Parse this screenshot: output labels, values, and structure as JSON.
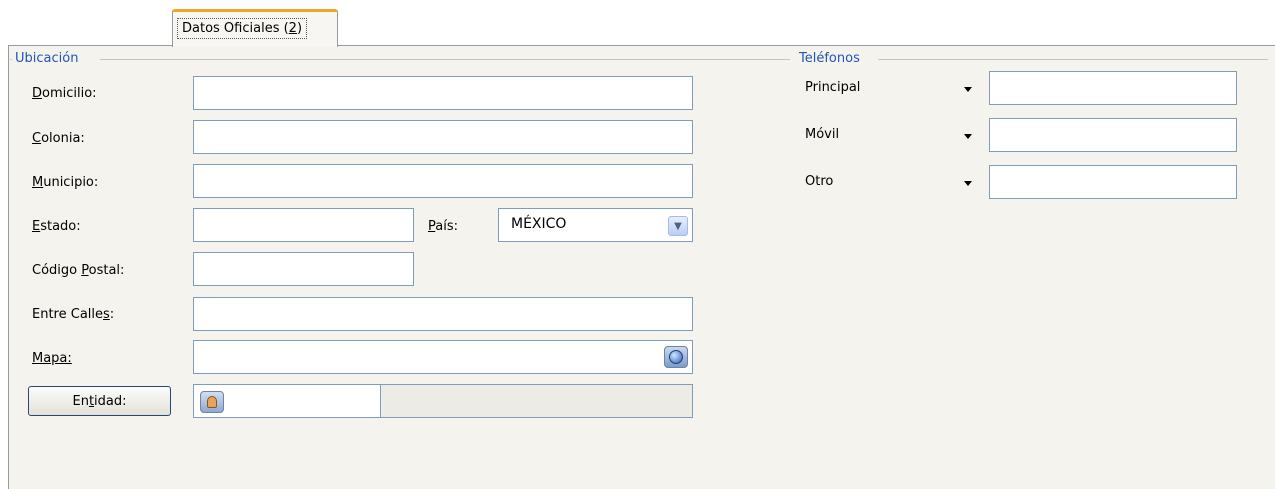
{
  "tab": {
    "label_prefix": "Datos Oficiales (",
    "label_accel": "2",
    "label_suffix": ")"
  },
  "ubicacion": {
    "title": "Ubicación",
    "domicilio": {
      "accel": "D",
      "rest": "omicilio:",
      "value": ""
    },
    "colonia": {
      "accel": "C",
      "rest": "olonia:",
      "value": ""
    },
    "municipio": {
      "accel": "M",
      "rest": "unicipio:",
      "value": ""
    },
    "estado": {
      "accel": "E",
      "rest": "stado:",
      "value": ""
    },
    "pais": {
      "accel": "P",
      "rest": "aís:",
      "selected": "MÉXICO"
    },
    "codigo_postal": {
      "pre": "Código ",
      "accel": "P",
      "rest": "ostal:",
      "value": ""
    },
    "entre_calles": {
      "pre": "Entre Calle",
      "accel": "s",
      "rest": ":",
      "value": ""
    },
    "mapa": {
      "label": "Mapa:",
      "value": ""
    },
    "entidad_button": {
      "pre": "En",
      "accel": "t",
      "rest": "idad:"
    }
  },
  "telefonos": {
    "title": "Teléfonos",
    "rows": [
      {
        "label": "Principal",
        "value": ""
      },
      {
        "label": "Móvil",
        "value": ""
      },
      {
        "label": "Otro",
        "value": ""
      }
    ]
  },
  "icons": {
    "pais_dropdown": "chevron-down-icon",
    "mapa": "globe-icon",
    "entidad": "person-search-icon",
    "phone_type": "dropdown-arrow-icon"
  }
}
